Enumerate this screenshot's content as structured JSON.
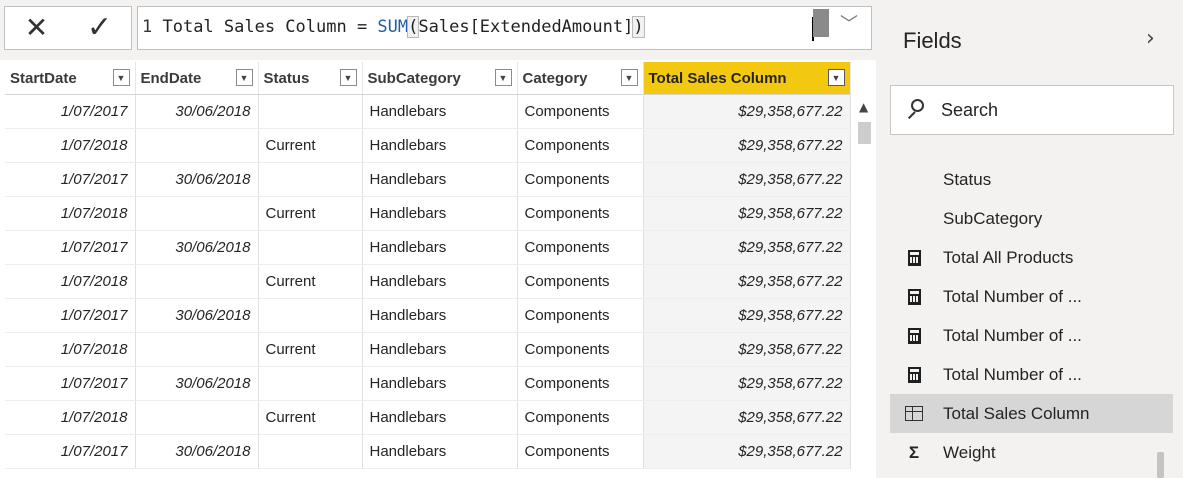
{
  "formula_bar": {
    "cancel_glyph": "✕",
    "commit_glyph": "✓",
    "line_number": "1",
    "formula_prefix": " Total Sales Column = ",
    "formula_function": "SUM",
    "formula_open_paren": "(",
    "formula_arg": "Sales[ExtendedAmount]",
    "formula_close_paren": ")",
    "expand_glyph": "﹀"
  },
  "grid": {
    "columns": [
      {
        "label": "StartDate",
        "width": 130
      },
      {
        "label": "EndDate",
        "width": 123
      },
      {
        "label": "Status",
        "width": 104
      },
      {
        "label": "SubCategory",
        "width": 155
      },
      {
        "label": "Category",
        "width": 126
      },
      {
        "label": "Total Sales Column",
        "width": 207
      }
    ],
    "active_column": 5,
    "rows": [
      [
        "1/07/2017",
        "30/06/2018",
        "",
        "Handlebars",
        "Components",
        "$29,358,677.22"
      ],
      [
        "1/07/2018",
        "",
        "Current",
        "Handlebars",
        "Components",
        "$29,358,677.22"
      ],
      [
        "1/07/2017",
        "30/06/2018",
        "",
        "Handlebars",
        "Components",
        "$29,358,677.22"
      ],
      [
        "1/07/2018",
        "",
        "Current",
        "Handlebars",
        "Components",
        "$29,358,677.22"
      ],
      [
        "1/07/2017",
        "30/06/2018",
        "",
        "Handlebars",
        "Components",
        "$29,358,677.22"
      ],
      [
        "1/07/2018",
        "",
        "Current",
        "Handlebars",
        "Components",
        "$29,358,677.22"
      ],
      [
        "1/07/2017",
        "30/06/2018",
        "",
        "Handlebars",
        "Components",
        "$29,358,677.22"
      ],
      [
        "1/07/2018",
        "",
        "Current",
        "Handlebars",
        "Components",
        "$29,358,677.22"
      ],
      [
        "1/07/2017",
        "30/06/2018",
        "",
        "Handlebars",
        "Components",
        "$29,358,677.22"
      ],
      [
        "1/07/2018",
        "",
        "Current",
        "Handlebars",
        "Components",
        "$29,358,677.22"
      ],
      [
        "1/07/2017",
        "30/06/2018",
        "",
        "Handlebars",
        "Components",
        "$29,358,677.22"
      ]
    ]
  },
  "fields_pane": {
    "title": "Fields",
    "collapse_glyph": "›",
    "search_placeholder": "Search",
    "items": [
      {
        "label": "Status",
        "icon": "none",
        "selected": false
      },
      {
        "label": "SubCategory",
        "icon": "none",
        "selected": false
      },
      {
        "label": "Total All Products",
        "icon": "calculator-icon",
        "selected": false
      },
      {
        "label": "Total Number of ...",
        "icon": "calculator-icon",
        "selected": false
      },
      {
        "label": "Total Number of ...",
        "icon": "calculator-icon",
        "selected": false
      },
      {
        "label": "Total Number of ...",
        "icon": "calculator-icon",
        "selected": false
      },
      {
        "label": "Total Sales Column",
        "icon": "calculated-column-icon",
        "selected": true
      },
      {
        "label": "Weight",
        "icon": "sigma-icon",
        "selected": false
      }
    ]
  },
  "colors": {
    "accent_header": "#f2c811",
    "pane_background": "#f3f2f1",
    "function_blue": "#1f5ea8"
  }
}
